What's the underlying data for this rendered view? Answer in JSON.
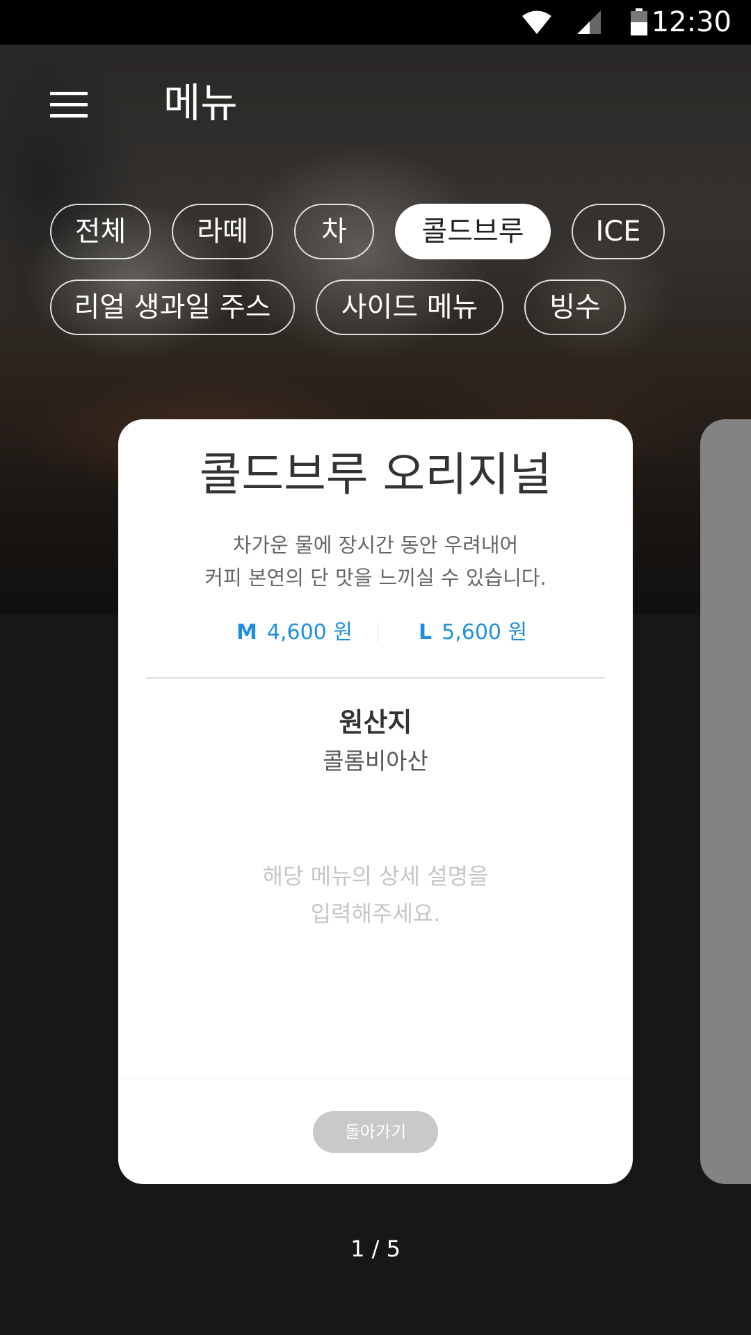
{
  "status_bar": {
    "time": "12:30",
    "icons": [
      "wifi-icon",
      "cell-signal-icon",
      "battery-icon"
    ]
  },
  "header": {
    "menu_icon": "hamburger-icon",
    "title": "메뉴"
  },
  "categories": [
    {
      "label": "전체",
      "active": false
    },
    {
      "label": "라떼",
      "active": false
    },
    {
      "label": "차",
      "active": false
    },
    {
      "label": "콜드브루",
      "active": true
    },
    {
      "label": "ICE",
      "active": false
    },
    {
      "label": "리얼 생과일 주스",
      "active": false
    },
    {
      "label": "사이드 메뉴",
      "active": false
    },
    {
      "label": "빙수",
      "active": false
    }
  ],
  "card": {
    "title": "콜드브루 오리지널",
    "description_lines": [
      "차가운 물에 장시간 동안 우려내어",
      "커피 본연의 단 맛을 느끼실 수 있습니다."
    ],
    "prices": [
      {
        "size": "M",
        "amount": "4,600 원"
      },
      {
        "size": "L",
        "amount": "5,600 원"
      }
    ],
    "origin_label": "원산지",
    "origin_value": "콜롬비아산",
    "detail_placeholder_lines": [
      "해당 메뉴의 상세 설명을",
      "입력해주세요."
    ],
    "back_button": "돌아가기"
  },
  "pager": "1 / 5",
  "colors": {
    "accent": "#1e8fe0",
    "active_chip_bg": "#ffffff",
    "back_button_bg": "#c9c9c9",
    "screen_bg": "#171717"
  }
}
